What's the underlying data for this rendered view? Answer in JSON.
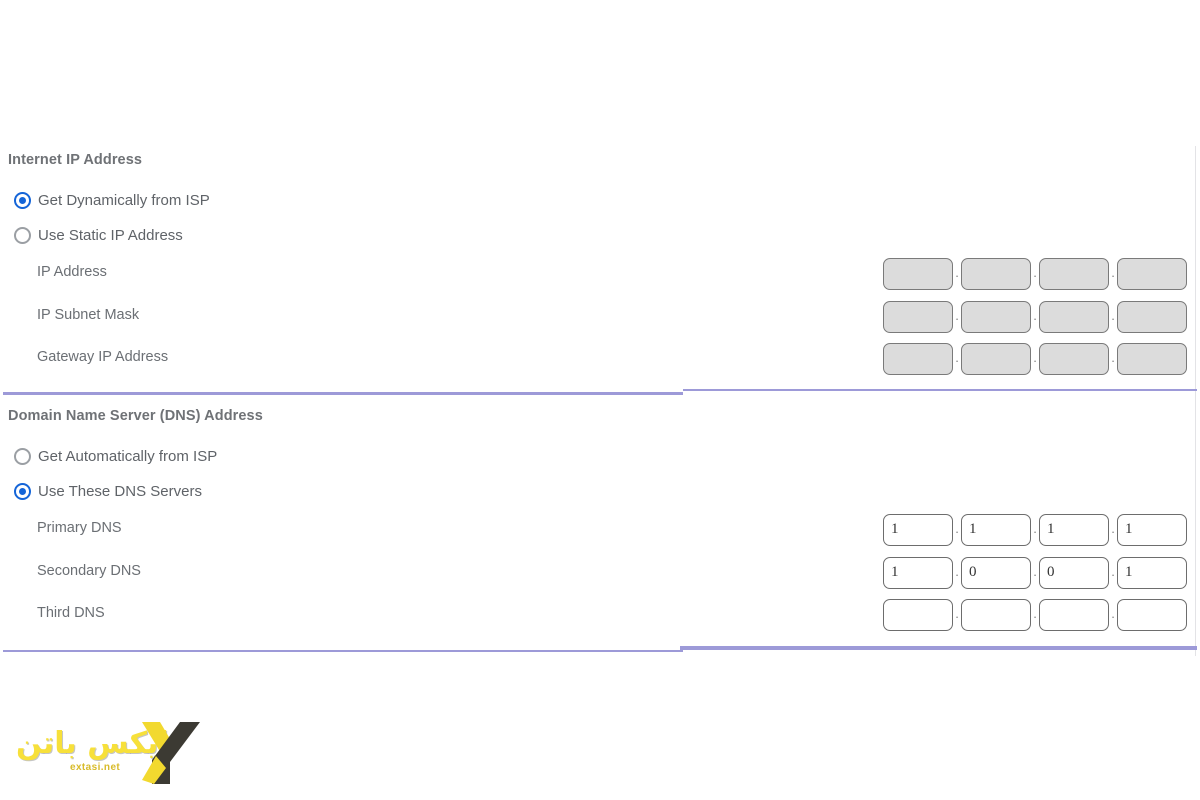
{
  "page": {
    "background_color": "#ffffff",
    "accent_divider_color": "#9d9ad8",
    "radio_selected_color": "#1565d8",
    "label_color": "#6b6f74",
    "disabled_field_color": "#dcdcdc"
  },
  "ip_section": {
    "title": "Internet IP Address",
    "options": [
      {
        "label": "Get Dynamically from ISP",
        "selected": true
      },
      {
        "label": "Use Static IP Address",
        "selected": false
      }
    ],
    "fields": [
      {
        "label": "IP Address",
        "disabled": true,
        "octets": [
          "",
          "",
          "",
          ""
        ]
      },
      {
        "label": "IP Subnet Mask",
        "disabled": true,
        "octets": [
          "",
          "",
          "",
          ""
        ]
      },
      {
        "label": "Gateway IP Address",
        "disabled": true,
        "octets": [
          "",
          "",
          "",
          ""
        ]
      }
    ]
  },
  "dns_section": {
    "title": "Domain Name Server (DNS) Address",
    "options": [
      {
        "label": "Get Automatically from ISP",
        "selected": false
      },
      {
        "label": "Use These DNS Servers",
        "selected": true
      }
    ],
    "fields": [
      {
        "label": "Primary DNS",
        "disabled": false,
        "octets": [
          "1",
          "1",
          "1",
          "1"
        ]
      },
      {
        "label": "Secondary DNS",
        "disabled": false,
        "octets": [
          "1",
          "0",
          "0",
          "1"
        ]
      },
      {
        "label": "Third DNS",
        "disabled": false,
        "octets": [
          "",
          "",
          "",
          ""
        ]
      }
    ]
  },
  "separator": ".",
  "watermark": {
    "title": "ایکس باتن",
    "subtitle": "extasi.net",
    "color": "#f7e03a",
    "mark": "X"
  }
}
